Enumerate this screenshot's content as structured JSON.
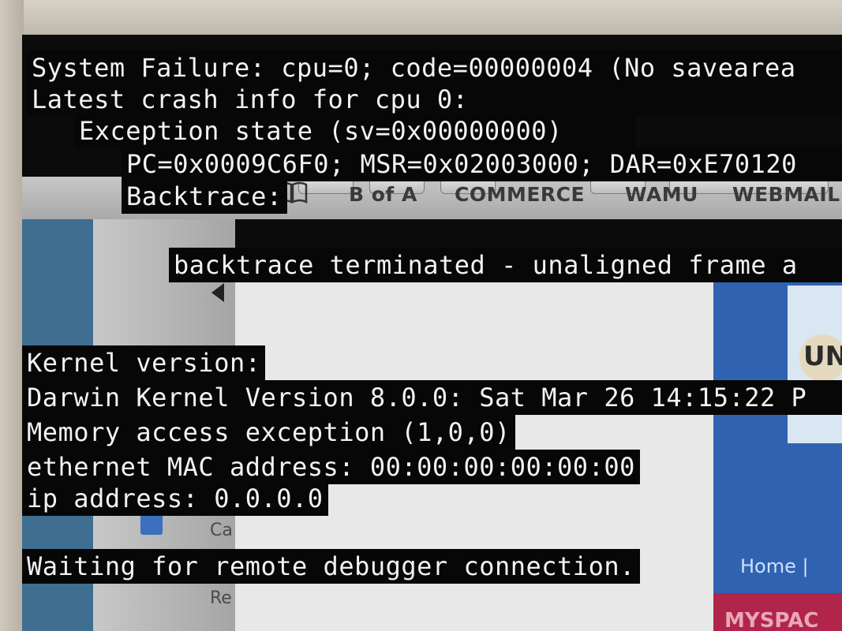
{
  "gui": {
    "bookmarks": [
      "B of A",
      "COMMERCE",
      "WAMU",
      "WEBMAIL"
    ],
    "sidebar_items": [
      "Ca",
      "Re"
    ],
    "right_nav": "Home |",
    "right_banner": "MYSPAC",
    "right_logo": "UN"
  },
  "panic": {
    "line1": "System Failure: cpu=0; code=00000004 (No savearea",
    "line2": "Latest crash info for cpu 0:",
    "line3": "Exception state (sv=0x00000000)",
    "line4": "PC=0x0009C6F0; MSR=0x02003000; DAR=0xE70120",
    "line5": "Backtrace:",
    "line6": "backtrace terminated - unaligned frame a",
    "line7": "Kernel version:",
    "line8": "Darwin Kernel Version 8.0.0: Sat Mar 26 14:15:22 P",
    "line9": "Memory access exception (1,0,0)",
    "line10": "ethernet MAC address: 00:00:00:00:00:00",
    "line11": "ip address: 0.0.0.0",
    "line12": "Waiting for remote debugger connection."
  }
}
